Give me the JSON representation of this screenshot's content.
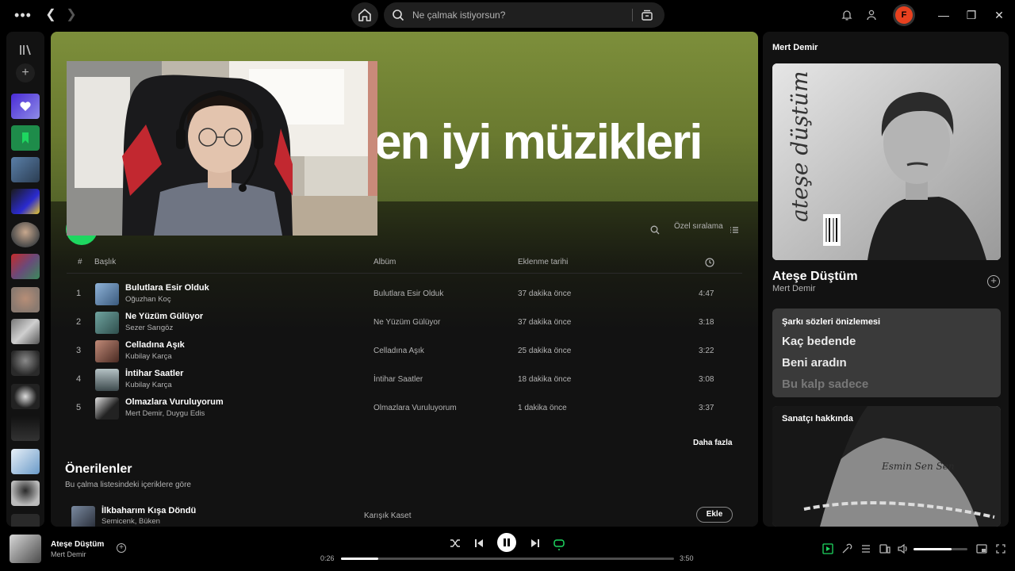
{
  "topbar": {
    "search_placeholder": "Ne çalmak istiyorsun?",
    "avatar_letter": "F"
  },
  "main": {
    "hero_title": "en iyi müzikleri",
    "sort_label": "Özel sıralama",
    "columns": {
      "num": "#",
      "title": "Başlık",
      "album": "Albüm",
      "added": "Eklenme tarihi"
    },
    "tracks": [
      {
        "num": "1",
        "title": "Bulutlara Esir Olduk",
        "artist": "Oğuzhan Koç",
        "album": "Bulutlara Esir Olduk",
        "added": "37 dakika önce",
        "duration": "4:47",
        "art_color": "#5a7fa8"
      },
      {
        "num": "2",
        "title": "Ne Yüzüm Gülüyor",
        "artist": "Sezer Sarıgöz",
        "album": "Ne Yüzüm Gülüyor",
        "added": "37 dakika önce",
        "duration": "3:18",
        "art_color": "#4f7f7d"
      },
      {
        "num": "3",
        "title": "Celladına Aşık",
        "artist": "Kubilay Karça",
        "album": "Celladına Aşık",
        "added": "25 dakika önce",
        "duration": "3:22",
        "art_color": "#8a5a4c"
      },
      {
        "num": "4",
        "title": "İntihar Saatler",
        "artist": "Kubilay Karça",
        "album": "İntihar Saatler",
        "added": "18 dakika önce",
        "duration": "3:08",
        "art_color": "#6f7d80"
      },
      {
        "num": "5",
        "title": "Olmazlara Vuruluyorum",
        "artist": "Mert Demir, Duygu Edis",
        "album": "Olmazlara Vuruluyorum",
        "added": "1 dakika önce",
        "duration": "3:37",
        "art_color": "#3b3b3b"
      }
    ],
    "more_label": "Daha fazla",
    "recommended": {
      "title": "Önerilenler",
      "subtitle": "Bu çalma listesindeki içeriklere göre",
      "item": {
        "title": "İlkbaharım Kışa Döndü",
        "artist": "Semicenk, Büken",
        "album": "Karışık Kaset",
        "add_label": "Ekle"
      }
    }
  },
  "right_panel": {
    "header": "Mert Demir",
    "cover_text": "ateşe düştüm",
    "now_playing_title": "Ateşe Düştüm",
    "now_playing_artist": "Mert Demir",
    "lyrics_header": "Şarkı sözleri önizlemesi",
    "lyrics_lines": [
      "Kaç bedende",
      "Beni aradın",
      "Bu kalp sadece"
    ],
    "about_header": "Sanatçı hakkında",
    "about_image_text": "Esmin Sen Sen"
  },
  "player": {
    "title": "Ateşe Düştüm",
    "artist": "Mert Demir",
    "elapsed": "0:26",
    "total": "3:50",
    "progress": 0.113,
    "volume": 0.7
  },
  "colors": {
    "accent": "#1ed760",
    "hero": "#7d8f3b"
  }
}
